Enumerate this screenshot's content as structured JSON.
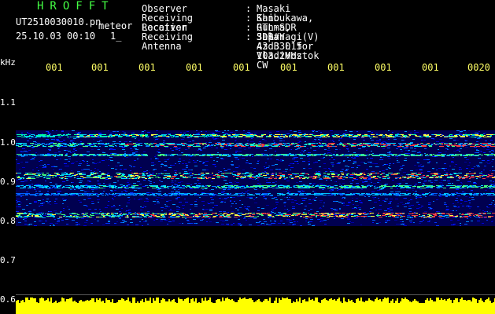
{
  "app": {
    "title": "HROFFT"
  },
  "file": {
    "name": "UT2510030010.pn",
    "suffix": "meteor",
    "datetime": "25.10.03 00:10",
    "counter": "1_"
  },
  "info": [
    {
      "label": "Observer",
      "sep": ":",
      "value": "Masaki Kano"
    },
    {
      "label": "Receiving Location",
      "sep": ":",
      "value": "Shibukawa, Gunma, Japan"
    },
    {
      "label": "Receiver",
      "sep": ":",
      "value": "RTL-SDR SDR# 43dB L15 103.2MHz CW"
    },
    {
      "label": "Receiving Antenna",
      "sep": ":",
      "value": "3el Yagi(V) Az 330 for Vladivostok"
    }
  ],
  "axis": {
    "y_unit": "kHz",
    "y_ticks": [
      "1.1",
      "1.0",
      "0.9",
      "0.8",
      "0.7",
      "0.6"
    ],
    "x_ticks": [
      "001",
      "001",
      "001",
      "001",
      "001",
      "001",
      "001",
      "001",
      "001",
      "0020"
    ]
  },
  "colors": {
    "background": "#000000",
    "tick_text": "#ffff66",
    "info_text": "#ffffff",
    "title": "#44ff44",
    "baseline": "#ffff00",
    "noise_blue": "#0000c8"
  }
}
